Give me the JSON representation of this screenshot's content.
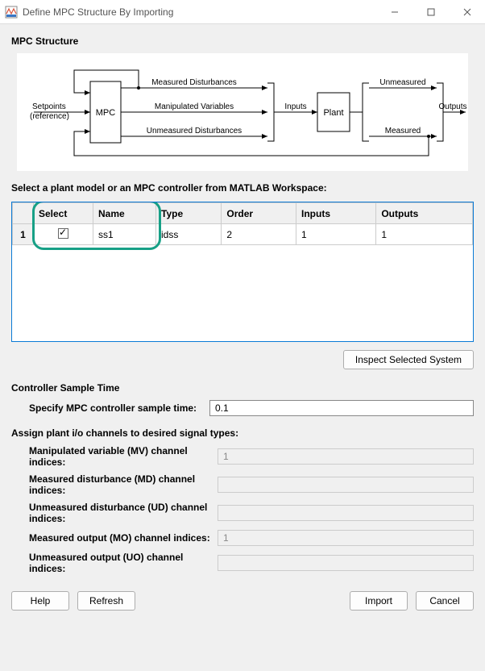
{
  "window": {
    "title": "Define MPC Structure By Importing"
  },
  "headings": {
    "structure": "MPC Structure",
    "select_prompt": "Select a plant model or an MPC controller from MATLAB Workspace:",
    "sample_time": "Controller Sample Time",
    "assign_channels": "Assign plant i/o channels to desired signal types:"
  },
  "diagram": {
    "setpoints1": "Setpoints",
    "setpoints2": "(reference)",
    "mpc": "MPC",
    "meas_dist": "Measured Disturbances",
    "manip_vars": "Manipulated Variables",
    "unmeas_dist": "Unmeasured Disturbances",
    "inputs": "Inputs",
    "plant": "Plant",
    "unmeasured": "Unmeasured",
    "measured": "Measured",
    "outputs": "Outputs"
  },
  "table": {
    "headers": {
      "select": "Select",
      "name": "Name",
      "type": "Type",
      "order": "Order",
      "inputs": "Inputs",
      "outputs": "Outputs"
    },
    "row1": {
      "num": "1",
      "name": "ss1",
      "type": "idss",
      "order": "2",
      "inputs": "1",
      "outputs": "1"
    }
  },
  "buttons": {
    "inspect": "Inspect Selected System",
    "help": "Help",
    "refresh": "Refresh",
    "import": "Import",
    "cancel": "Cancel"
  },
  "sample": {
    "label": "Specify MPC controller sample time:",
    "value": "0.1"
  },
  "channels": {
    "mv_label": "Manipulated variable (MV) channel indices:",
    "mv_val": "1",
    "md_label": "Measured disturbance (MD) channel indices:",
    "md_val": "",
    "ud_label": "Unmeasured disturbance (UD) channel indices:",
    "ud_val": "",
    "mo_label": "Measured output (MO) channel indices:",
    "mo_val": "1",
    "uo_label": "Unmeasured output (UO) channel indices:",
    "uo_val": ""
  }
}
